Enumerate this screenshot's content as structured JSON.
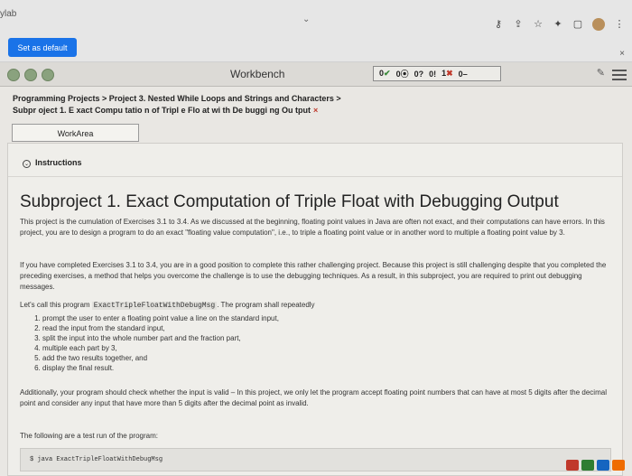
{
  "browser": {
    "tab_fragment": "ylab",
    "set_default_label": "Set as default",
    "close": "×"
  },
  "workbench": {
    "title": "Workbench",
    "status": [
      {
        "text": "0",
        "mark": "✔",
        "kind": "check"
      },
      {
        "text": "0⦿",
        "mark": "",
        "kind": "neutral"
      },
      {
        "text": "0?",
        "mark": "",
        "kind": "neutral"
      },
      {
        "text": "0!",
        "mark": "",
        "kind": "neutral"
      },
      {
        "text": "1",
        "mark": "✖",
        "kind": "x"
      },
      {
        "text": "0",
        "mark": "–",
        "kind": "neutral"
      }
    ]
  },
  "breadcrumb": {
    "line1": "Programming Projects > Project 3. Nested While Loops and Strings and Characters >",
    "line2": "Subpr oject 1. E xact Compu tatio n of Tripl e Flo at wi th De buggi ng Ou tput",
    "close": "×"
  },
  "workarea": {
    "tab_label": "WorkArea"
  },
  "instructions": {
    "label": "Instructions",
    "heading": "Subproject 1. Exact Computation of Triple Float with Debugging Output",
    "p1": "This project is the cumulation of Exercises 3.1 to 3.4. As we discussed at the beginning, floating point values in Java are often not exact, and their computations can have errors. In this project, you are to design a program to do an exact \"floating value computation\", i.e., to triple a floating point value or in another word to multiple a floating point value by 3.",
    "p2": "If you have completed Exercises 3.1 to 3.4, you are in a good position to complete this rather challenging project. Because this project is still challenging despite that you completed the preceding exercises, a method that helps you overcome the challenge is to use the debugging techniques. As a result, in this subproject, you are required to print out debugging messages.",
    "p3_prefix": "Let's call this program ",
    "p3_code": "ExactTripleFloatWithDebugMsg",
    "p3_suffix": ". The program shall repeatedly",
    "steps": [
      "prompt the user to enter a floating point value a line on the standard input,",
      "read the input from the standard input,",
      "split the input into the whole number part and the fraction part,",
      "multiple each part by 3,",
      "add the two results together, and",
      "display the final result."
    ],
    "p4": "Additionally, your program should check whether the input is valid – In this project, we only let the program accept floating point numbers that can have at most 5 digits after the decimal point and consider any input that have more than 5 digits after the decimal point as invalid.",
    "p5": "The following are a test run of the program:",
    "code_line": "$ java ExactTripleFloatWithDebugMsg"
  },
  "colors": {
    "accent": "#1a73e8",
    "check": "#3a8a3a",
    "error": "#c0392b"
  }
}
